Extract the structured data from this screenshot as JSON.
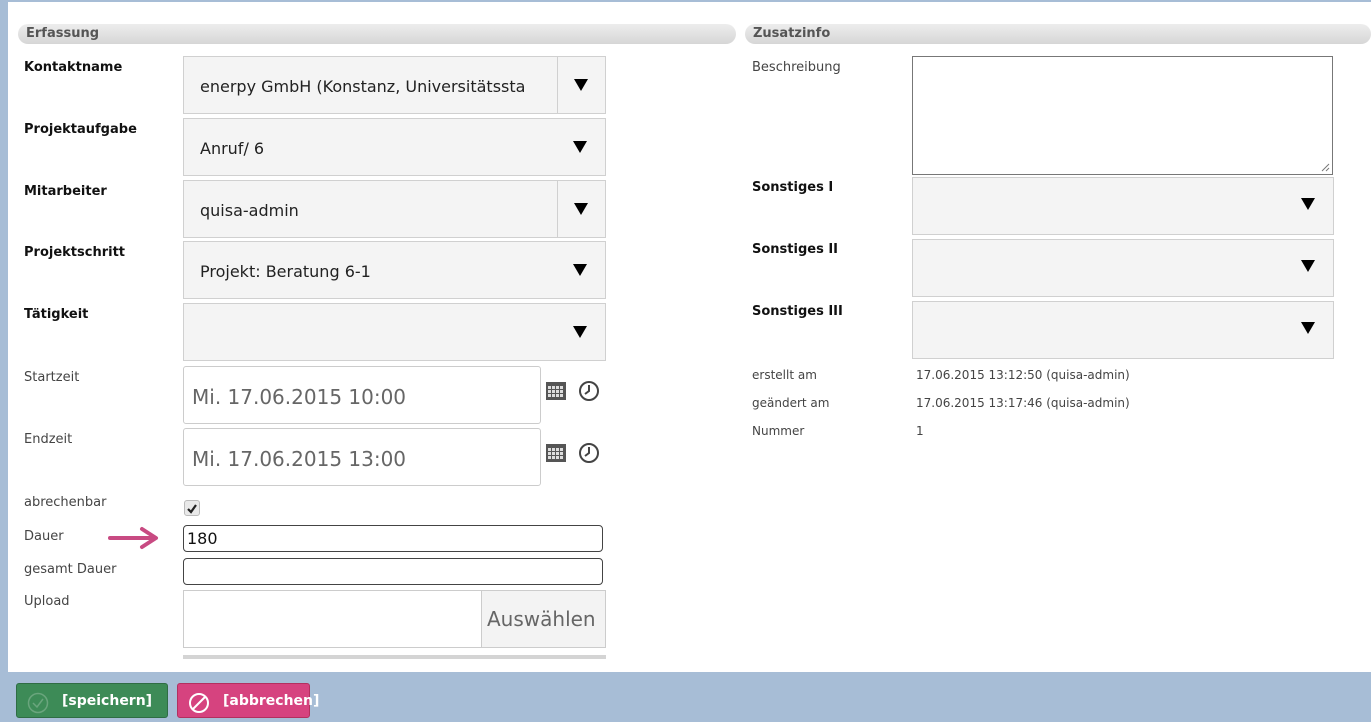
{
  "sections": {
    "erfassung": "Erfassung",
    "zusatzinfo": "Zusatzinfo"
  },
  "fields": {
    "kontaktname": {
      "label": "Kontaktname",
      "value": "enerpy GmbH (Konstanz, Universitätssta"
    },
    "projektaufgabe": {
      "label": "Projektaufgabe",
      "value": "Anruf/ 6"
    },
    "mitarbeiter": {
      "label": "Mitarbeiter",
      "value": "quisa-admin"
    },
    "projektschritt": {
      "label": "Projektschritt",
      "value": "Projekt: Beratung 6-1"
    },
    "taetigkeit": {
      "label": "Tätigkeit",
      "value": ""
    },
    "startzeit": {
      "label": "Startzeit",
      "value": "Mi. 17.06.2015 10:00"
    },
    "endzeit": {
      "label": "Endzeit",
      "value": "Mi. 17.06.2015 13:00"
    },
    "abrechenbar": {
      "label": "abrechenbar",
      "checked": true
    },
    "dauer": {
      "label": "Dauer",
      "value": "180"
    },
    "gesamt_dauer": {
      "label": "gesamt Dauer",
      "value": ""
    },
    "upload": {
      "label": "Upload",
      "button": "Auswählen"
    }
  },
  "zusatz": {
    "beschreibung": {
      "label": "Beschreibung",
      "value": ""
    },
    "sonstiges1": {
      "label": "Sonstiges I",
      "value": ""
    },
    "sonstiges2": {
      "label": "Sonstiges II",
      "value": ""
    },
    "sonstiges3": {
      "label": "Sonstiges III",
      "value": ""
    },
    "erstellt_am": {
      "label": "erstellt am",
      "value": "17.06.2015 13:12:50 (quisa-admin)"
    },
    "geaendert_am": {
      "label": "geändert am",
      "value": "17.06.2015 13:17:46 (quisa-admin)"
    },
    "nummer": {
      "label": "Nummer",
      "value": "1"
    }
  },
  "footer": {
    "save_label": "[speichern]",
    "cancel_label": "[abbrechen]"
  },
  "colors": {
    "frame": "#a7bdd6",
    "save": "#3d8b57",
    "cancel": "#d6437f",
    "arrow": "#c84a82"
  },
  "icons": [
    "calendar-icon",
    "clock-icon",
    "check-icon",
    "check-circle-icon",
    "ban-icon",
    "arrow-right-icon"
  ]
}
